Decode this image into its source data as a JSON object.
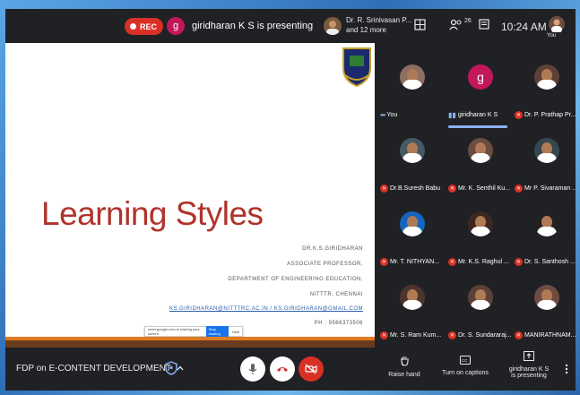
{
  "topbar": {
    "rec_label": "REC",
    "presenter_initial": "g",
    "presenter_text": "giridharan K S is presenting",
    "viewer_line1": "Dr. R. Srinivasan P...",
    "viewer_line2": "and 12 more",
    "participants_count": "26",
    "time": "10:24 AM",
    "me_label": "You"
  },
  "slide": {
    "title": "Learning Styles",
    "lines": [
      "DR.K.S.GIRIDHARAN",
      "ASSOCIATE PROFESSOR,",
      "DEPARTMENT OF ENGINEERING EDUCATION,",
      "NITTTR, CHENNAI"
    ],
    "emails": "KS.GIRIDHARAN@NITTTRC.AC.IN / KS.GIRIDHARAN@GMAIL.COM",
    "phone": "PH : 9566373506",
    "share_bar_text": "meet.google.com is sharing your screen",
    "share_bar_stop": "Stop sharing",
    "share_bar_hide": "Hide"
  },
  "participants": [
    {
      "name": "You",
      "type": "you",
      "color": "#8d6e63"
    },
    {
      "name": "giridharan K S",
      "type": "speaking",
      "initial": "g",
      "color": "#c2185b"
    },
    {
      "name": "Dr. P. Prathap Pr...",
      "type": "muted",
      "color": "#5d4037"
    },
    {
      "name": "Dr.B.Suresh Babu",
      "type": "muted",
      "color": "#455a64"
    },
    {
      "name": "Mr. K. Senthil Ku...",
      "type": "muted",
      "color": "#6d4c41"
    },
    {
      "name": "Mr P. Sivaraman ...",
      "type": "muted",
      "color": "#37474f"
    },
    {
      "name": "Mr. T. NITHYAN...",
      "type": "muted",
      "color": "#1565c0"
    },
    {
      "name": "Mr. K.S. Raghul ...",
      "type": "muted",
      "color": "#3e2723"
    },
    {
      "name": "Dr. S. Santhosh ...",
      "type": "muted",
      "color": "#212121"
    },
    {
      "name": "Mr. S. Ram Kum...",
      "type": "muted",
      "color": "#4e342e"
    },
    {
      "name": "Dr. S. Sundararaj...",
      "type": "muted",
      "color": "#5d4037"
    },
    {
      "name": "MANIRATHNAM...",
      "type": "muted",
      "color": "#6d4c41"
    }
  ],
  "bottombar": {
    "meeting_name": "FDP on E-CONTENT DEVELOPMENT",
    "raise_hand": "Raise hand",
    "captions": "Turn on captions",
    "present_line1": "giridharan K S",
    "present_line2": "is presenting"
  },
  "colors": {
    "background": "#202124",
    "rec_red": "#d93025",
    "title_red": "#b0332b",
    "accent_blue": "#8ab4f8"
  }
}
